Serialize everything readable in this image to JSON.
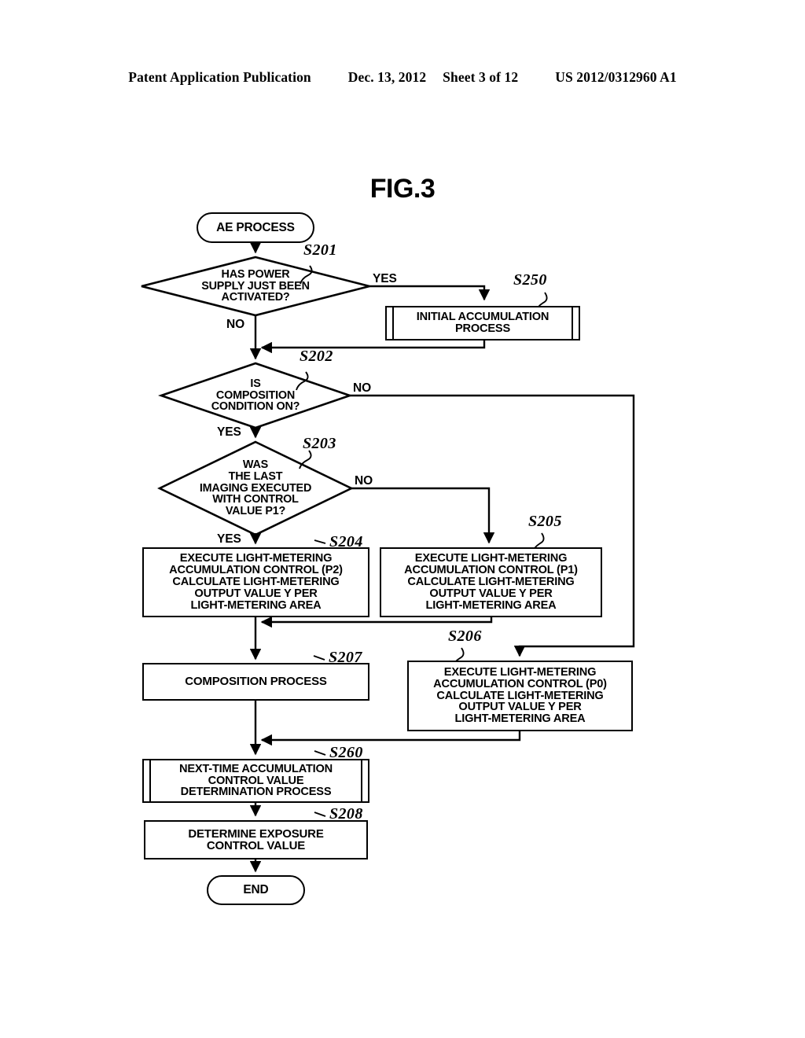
{
  "header": {
    "publication": "Patent Application Publication",
    "date": "Dec. 13, 2012",
    "sheet": "Sheet 3 of 12",
    "doc_number": "US 2012/0312960 A1"
  },
  "figure": {
    "title": "FIG.3"
  },
  "flowchart": {
    "start": {
      "label": "AE PROCESS"
    },
    "end": {
      "label": "END"
    },
    "nodes": [
      {
        "id": "S201",
        "ref": "S201",
        "type": "decision",
        "label": "HAS POWER\nSUPPLY JUST BEEN\nACTIVATED?"
      },
      {
        "id": "S250",
        "ref": "S250",
        "type": "predefined",
        "label": "INITIAL ACCUMULATION\nPROCESS"
      },
      {
        "id": "S202",
        "ref": "S202",
        "type": "decision",
        "label": "IS\nCOMPOSITION\nCONDITION ON?"
      },
      {
        "id": "S203",
        "ref": "S203",
        "type": "decision",
        "label": "WAS\nTHE LAST\nIMAGING EXECUTED\nWITH CONTROL\nVALUE P1?"
      },
      {
        "id": "S204",
        "ref": "S204",
        "type": "process",
        "label": "EXECUTE LIGHT-METERING\nACCUMULATION CONTROL (P2)\nCALCULATE LIGHT-METERING\nOUTPUT VALUE Y PER\nLIGHT-METERING AREA"
      },
      {
        "id": "S205",
        "ref": "S205",
        "type": "process",
        "label": "EXECUTE LIGHT-METERING\nACCUMULATION CONTROL (P1)\nCALCULATE LIGHT-METERING\nOUTPUT VALUE Y PER\nLIGHT-METERING AREA"
      },
      {
        "id": "S206",
        "ref": "S206",
        "type": "process",
        "label": "EXECUTE LIGHT-METERING\nACCUMULATION CONTROL (P0)\nCALCULATE LIGHT-METERING\nOUTPUT VALUE Y PER\nLIGHT-METERING AREA"
      },
      {
        "id": "S207",
        "ref": "S207",
        "type": "process",
        "label": "COMPOSITION PROCESS"
      },
      {
        "id": "S260",
        "ref": "S260",
        "type": "predefined",
        "label": "NEXT-TIME ACCUMULATION\nCONTROL VALUE\nDETERMINATION PROCESS"
      },
      {
        "id": "S208",
        "ref": "S208",
        "type": "process",
        "label": "DETERMINE EXPOSURE\nCONTROL VALUE"
      }
    ],
    "branch_labels": {
      "s201_yes": "YES",
      "s201_no": "NO",
      "s202_no": "NO",
      "s202_yes": "YES",
      "s203_no": "NO",
      "s203_yes": "YES"
    }
  },
  "colors": {
    "ink": "#000000",
    "paper": "#ffffff"
  }
}
